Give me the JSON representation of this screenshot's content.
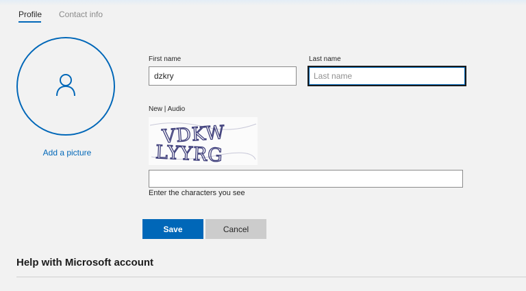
{
  "tabs": {
    "profile": "Profile",
    "contact": "Contact info"
  },
  "avatar": {
    "icon": "person-icon",
    "add_picture": "Add a picture"
  },
  "form": {
    "first_name_label": "First name",
    "first_name_value": "dzkry",
    "last_name_label": "Last name",
    "last_name_placeholder": "Last name",
    "captcha_new": "New",
    "captcha_sep": " | ",
    "captcha_audio": "Audio",
    "captcha_text_line1": "VDKW",
    "captcha_text_line2": "LYYRG",
    "captcha_input_value": "",
    "captcha_hint": "Enter the characters you see"
  },
  "buttons": {
    "save": "Save",
    "cancel": "Cancel"
  },
  "help": {
    "heading": "Help with Microsoft account"
  },
  "colors": {
    "accent": "#0067b8",
    "cancel_bg": "#cccccc",
    "page_bg": "#f2f2f2"
  }
}
